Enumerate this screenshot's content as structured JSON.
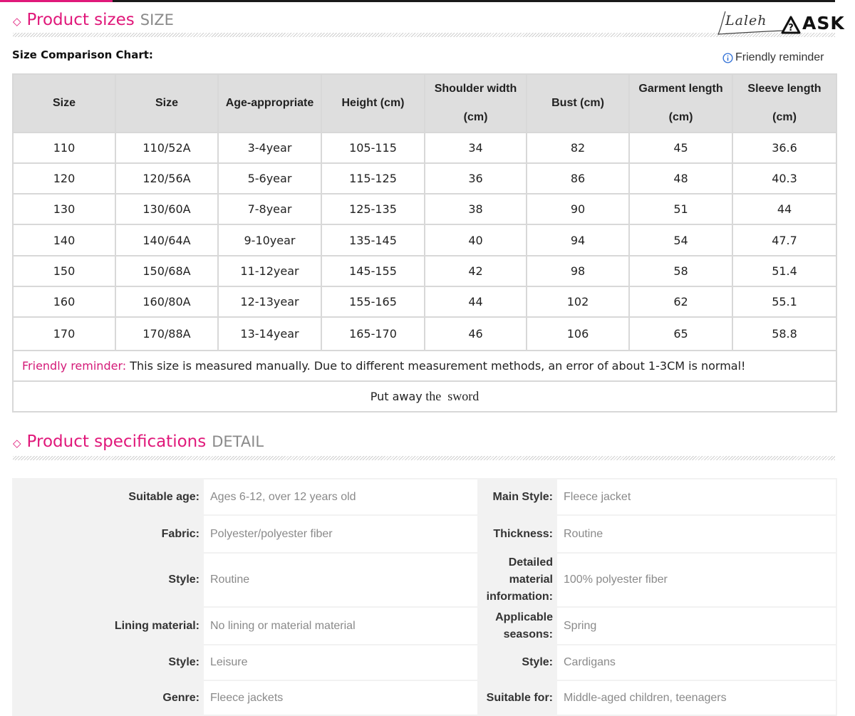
{
  "size_section": {
    "title": "Product sizes",
    "title_en": "SIZE"
  },
  "brand": {
    "script_text": "Laleh",
    "ask_text": "ASK"
  },
  "chart_label": "Size Comparison Chart:",
  "reminder_link": "Friendly reminder",
  "size_table": {
    "headers": [
      "Size",
      "Size",
      "Age-appropriate",
      "Height (cm)",
      "Shoulder width (cm)",
      "Bust (cm)",
      "Garment length (cm)",
      "Sleeve length (cm)"
    ],
    "rows": [
      [
        "110",
        "110/52A",
        "3-4year",
        "105-115",
        "34",
        "82",
        "45",
        "36.6"
      ],
      [
        "120",
        "120/56A",
        "5-6year",
        "115-125",
        "36",
        "86",
        "48",
        "40.3"
      ],
      [
        "130",
        "130/60A",
        "7-8year",
        "125-135",
        "38",
        "90",
        "51",
        "44"
      ],
      [
        "140",
        "140/64A",
        "9-10year",
        "135-145",
        "40",
        "94",
        "54",
        "47.7"
      ],
      [
        "150",
        "150/68A",
        "11-12year",
        "145-155",
        "42",
        "98",
        "58",
        "51.4"
      ],
      [
        "160",
        "160/80A",
        "12-13year",
        "155-165",
        "44",
        "102",
        "62",
        "55.1"
      ],
      [
        "170",
        "170/88A",
        "13-14year",
        "165-170",
        "46",
        "106",
        "65",
        "58.8"
      ]
    ],
    "note_label": "Friendly reminder:",
    "note_text": " This size is measured manually. Due to different measurement methods, an error of about 1-3CM is normal!",
    "putaway_a": "Put away",
    "putaway_b": " the  sword"
  },
  "spec_section": {
    "title": "Product specifications",
    "title_en": "DETAIL"
  },
  "specs": [
    [
      {
        "k": "Suitable age:",
        "v": "Ages 6-12, over 12 years old"
      },
      {
        "k": "Main Style:",
        "v": "Fleece jacket"
      }
    ],
    [
      {
        "k": "Fabric:",
        "v": "Polyester/polyester fiber"
      },
      {
        "k": "Thickness:",
        "v": "Routine"
      }
    ],
    [
      {
        "k": "Style:",
        "v": "Routine"
      },
      {
        "k": "Detailed material information:",
        "v": "100% polyester fiber"
      }
    ],
    [
      {
        "k": "Lining material:",
        "v": "No lining or material material"
      },
      {
        "k": "Applicable seasons:",
        "v": "Spring"
      }
    ],
    [
      {
        "k": "Style:",
        "v": "Leisure"
      },
      {
        "k": "Style:",
        "v": "Cardigans"
      }
    ],
    [
      {
        "k": "Genre:",
        "v": "Fleece jackets"
      },
      {
        "k": "Suitable for:",
        "v": "Middle-aged children, teenagers"
      }
    ]
  ],
  "colors": {
    "accent": "#e0187a",
    "header_bg": "#dedede",
    "border": "#d8d8d8",
    "spec_bg": "#f2f2f2",
    "spec_value": "#8a8a8a"
  }
}
